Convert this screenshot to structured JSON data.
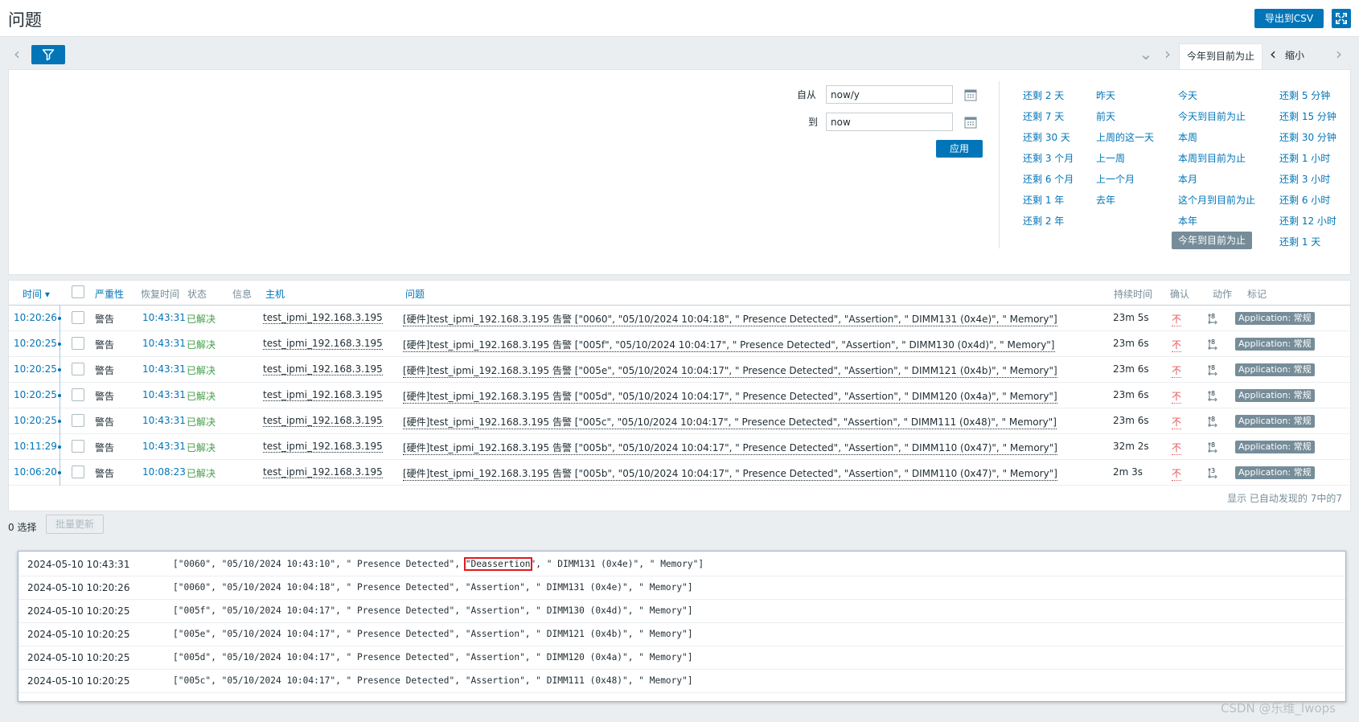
{
  "header": {
    "title": "问题",
    "export_label": "导出到CSV"
  },
  "filter": {
    "active_time_tab": "今年到目前为止",
    "zoom_out_label": "缩小"
  },
  "time_picker": {
    "from_label": "自从",
    "from_value": "now/y",
    "to_label": "到",
    "to_value": "now",
    "apply_label": "应用",
    "quick": [
      [
        "还剩 2 天",
        "还剩 7 天",
        "还剩 30 天",
        "还剩 3 个月",
        "还剩 6 个月",
        "还剩 1 年",
        "还剩 2 年"
      ],
      [
        "昨天",
        "前天",
        "上周的这一天",
        "上一周",
        "上一个月",
        "去年"
      ],
      [
        "今天",
        "今天到目前为止",
        "本周",
        "本周到目前为止",
        "本月",
        "这个月到目前为止",
        "本年",
        "今年到目前为止"
      ],
      [
        "还剩 5 分钟",
        "还剩 15 分钟",
        "还剩 30 分钟",
        "还剩 1 小时",
        "还剩 3 小时",
        "还剩 6 小时",
        "还剩 12 小时",
        "还剩 1 天"
      ]
    ]
  },
  "table": {
    "headers": {
      "time": "时间 ▾",
      "severity": "严重性",
      "recovery": "恢复时间",
      "status": "状态",
      "info": "信息",
      "host": "主机",
      "problem": "问题",
      "duration": "持续时间",
      "ack": "确认",
      "actions": "动作",
      "tags": "标记"
    },
    "rows": [
      {
        "time": "10:20:26",
        "severity": "警告",
        "recovery": "10:43:31",
        "status": "已解决",
        "host": "test_ipmi_192.168.3.195",
        "problem": "[硬件]test_ipmi_192.168.3.195 告警 [\"0060\", \"05/10/2024 10:04:18\", \" Presence Detected\", \"Assertion\", \" DIMM131 (0x4e)\", \" Memory\"]",
        "duration": "23m 5s",
        "ack": "不",
        "action_count": "8",
        "tag": "Application: 常规"
      },
      {
        "time": "10:20:25",
        "severity": "警告",
        "recovery": "10:43:31",
        "status": "已解决",
        "host": "test_ipmi_192.168.3.195",
        "problem": "[硬件]test_ipmi_192.168.3.195 告警 [\"005f\", \"05/10/2024 10:04:17\", \" Presence Detected\", \"Assertion\", \" DIMM130 (0x4d)\", \" Memory\"]",
        "duration": "23m 6s",
        "ack": "不",
        "action_count": "8",
        "tag": "Application: 常规"
      },
      {
        "time": "10:20:25",
        "severity": "警告",
        "recovery": "10:43:31",
        "status": "已解决",
        "host": "test_ipmi_192.168.3.195",
        "problem": "[硬件]test_ipmi_192.168.3.195 告警 [\"005e\", \"05/10/2024 10:04:17\", \" Presence Detected\", \"Assertion\", \" DIMM121 (0x4b)\", \" Memory\"]",
        "duration": "23m 6s",
        "ack": "不",
        "action_count": "8",
        "tag": "Application: 常规"
      },
      {
        "time": "10:20:25",
        "severity": "警告",
        "recovery": "10:43:31",
        "status": "已解决",
        "host": "test_ipmi_192.168.3.195",
        "problem": "[硬件]test_ipmi_192.168.3.195 告警 [\"005d\", \"05/10/2024 10:04:17\", \" Presence Detected\", \"Assertion\", \" DIMM120 (0x4a)\", \" Memory\"]",
        "duration": "23m 6s",
        "ack": "不",
        "action_count": "8",
        "tag": "Application: 常规"
      },
      {
        "time": "10:20:25",
        "severity": "警告",
        "recovery": "10:43:31",
        "status": "已解决",
        "host": "test_ipmi_192.168.3.195",
        "problem": "[硬件]test_ipmi_192.168.3.195 告警 [\"005c\", \"05/10/2024 10:04:17\", \" Presence Detected\", \"Assertion\", \" DIMM111 (0x48)\", \" Memory\"]",
        "duration": "23m 6s",
        "ack": "不",
        "action_count": "8",
        "tag": "Application: 常规"
      },
      {
        "time": "10:11:29",
        "severity": "警告",
        "recovery": "10:43:31",
        "status": "已解决",
        "host": "test_ipmi_192.168.3.195",
        "problem": "[硬件]test_ipmi_192.168.3.195 告警 [\"005b\", \"05/10/2024 10:04:17\", \" Presence Detected\", \"Assertion\", \" DIMM110 (0x47)\", \" Memory\"]",
        "duration": "32m 2s",
        "ack": "不",
        "action_count": "8",
        "tag": "Application: 常规"
      },
      {
        "time": "10:06:20",
        "severity": "警告",
        "recovery": "10:08:23",
        "status": "已解决",
        "host": "test_ipmi_192.168.3.195",
        "problem": "[硬件]test_ipmi_192.168.3.195 告警 [\"005b\", \"05/10/2024 10:04:17\", \" Presence Detected\", \"Assertion\", \" DIMM110 (0x47)\", \" Memory\"]",
        "duration": "2m 3s",
        "ack": "不",
        "action_count": "3",
        "tag": "Application: 常规"
      }
    ],
    "footer": "显示 已自动发现的 7中的7"
  },
  "bulk": {
    "selected_label": "0 选择",
    "mass_update_label": "批量更新"
  },
  "history": [
    {
      "time": "2024-05-10 10:43:31",
      "before": "[\"0060\", \"05/10/2024 10:43:10\", \" Presence Detected\", ",
      "highlight": "\"Deassertion",
      "after": "\", \" DIMM131 (0x4e)\", \" Memory\"]"
    },
    {
      "time": "2024-05-10 10:20:26",
      "value": "[\"0060\", \"05/10/2024 10:04:18\", \" Presence Detected\", \"Assertion\", \" DIMM131 (0x4e)\", \" Memory\"]"
    },
    {
      "time": "2024-05-10 10:20:25",
      "value": "[\"005f\", \"05/10/2024 10:04:17\", \" Presence Detected\", \"Assertion\", \" DIMM130 (0x4d)\", \" Memory\"]"
    },
    {
      "time": "2024-05-10 10:20:25",
      "value": "[\"005e\", \"05/10/2024 10:04:17\", \" Presence Detected\", \"Assertion\", \" DIMM121 (0x4b)\", \" Memory\"]"
    },
    {
      "time": "2024-05-10 10:20:25",
      "value": "[\"005d\", \"05/10/2024 10:04:17\", \" Presence Detected\", \"Assertion\", \" DIMM120 (0x4a)\", \" Memory\"]"
    },
    {
      "time": "2024-05-10 10:20:25",
      "value": "[\"005c\", \"05/10/2024 10:04:17\", \" Presence Detected\", \"Assertion\", \" DIMM111 (0x48)\", \" Memory\"]"
    }
  ],
  "watermark": "CSDN @乐维_lwops",
  "colors": {
    "accent": "#0275b8",
    "resolved": "#429e47",
    "ack_no": "#e45959",
    "tag_bg": "#768d99",
    "highlight_box": "#e0191e"
  },
  "icons": [
    "filter-icon",
    "fullscreen-icon",
    "calendar-icon",
    "chevron-left-icon",
    "chevron-right-icon",
    "chevron-down-icon",
    "actions-icon"
  ]
}
